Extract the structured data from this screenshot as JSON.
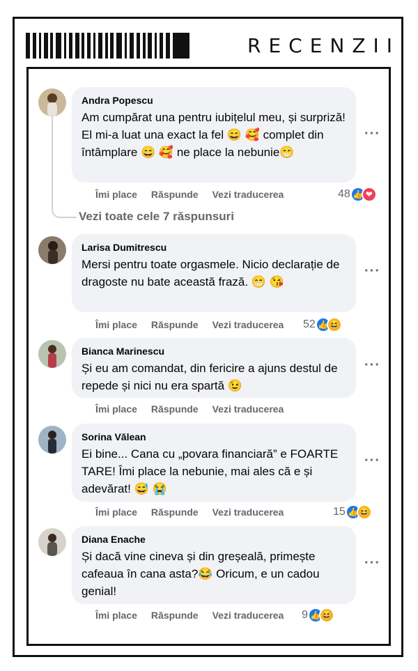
{
  "header": {
    "title": "RECENZII",
    "barcode_icon": "barcode-icon"
  },
  "comments": [
    {
      "name": "Andra Popescu",
      "text": "Am cumpărat una pentru iubițelul meu, și surpriză! El mi-a luat una exact la fel 😄 🥰 complet din întâmplare 😄 🥰  ne place la nebunie😁",
      "actions": {
        "like": "Îmi place",
        "reply": "Răspunde",
        "translate": "Vezi traducerea"
      },
      "reaction_count": "48",
      "reactions": [
        "like-icon",
        "love-icon"
      ]
    },
    {
      "name": "Larisa Dumitrescu",
      "text": "Mersi pentru toate orgasmele. Nicio declarație de dragoste nu bate această frază. 😁 😘",
      "actions": {
        "like": "Îmi place",
        "reply": "Răspunde",
        "translate": "Vezi traducerea"
      },
      "reaction_count": "52",
      "reactions": [
        "like-icon",
        "haha-icon"
      ]
    },
    {
      "name": "Bianca Marinescu",
      "text": "Și eu am comandat, din fericire a ajuns destul de repede și nici nu era spartă 😉",
      "actions": {
        "like": "Îmi place",
        "reply": "Răspunde",
        "translate": "Vezi traducerea"
      },
      "reaction_count": "",
      "reactions": []
    },
    {
      "name": "Sorina Vălean",
      "text": "Ei bine... Cana cu „povara financiară” e FOARTE TARE! Îmi place la nebunie, mai ales că e și adevărat! 😅 😭",
      "actions": {
        "like": "Îmi place",
        "reply": "Răspunde",
        "translate": "Vezi traducerea"
      },
      "reaction_count": "15",
      "reactions": [
        "like-icon",
        "haha-icon"
      ]
    },
    {
      "name": "Diana Enache",
      "text": "Și dacă vine cineva și din greșeală, primește cafeaua în cana asta?😂  Oricum, e un cadou genial!",
      "actions": {
        "like": "Îmi place",
        "reply": "Răspunde",
        "translate": "Vezi traducerea"
      },
      "reaction_count": "9",
      "reactions": [
        "like-icon",
        "haha-icon"
      ]
    }
  ],
  "thread": {
    "see_all_replies": "Vezi toate cele 7 răspunsuri"
  },
  "more_icon": "more-options-icon",
  "colors": {
    "bubble": "#f0f2f5",
    "meta_text": "#65676b",
    "like": "#1877f2",
    "love": "#f33e58",
    "haha": "#f7b125",
    "border": "#111111"
  }
}
